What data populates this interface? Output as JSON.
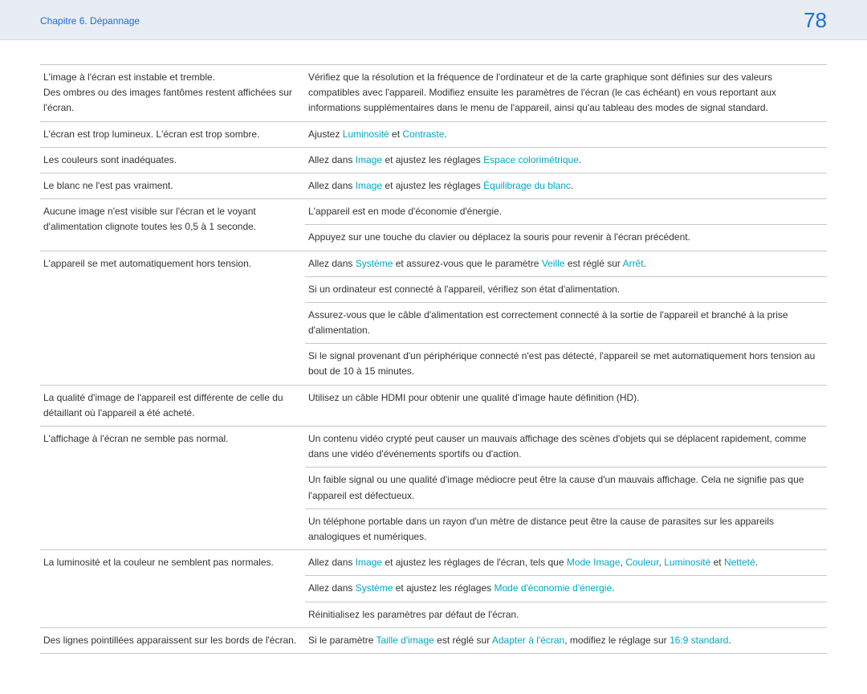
{
  "header": {
    "chapter": "Chapitre 6. Dépannage",
    "page": "78"
  },
  "terms": {
    "luminosite": "Luminosité",
    "contraste": "Contraste",
    "image": "Image",
    "espace_color": "Espace colorimétrique",
    "equilibrage_blanc": "Équilibrage du blanc",
    "systeme": "Système",
    "veille": "Veille",
    "arret": "Arrêt",
    "mode_image": "Mode Image",
    "couleur": "Couleur",
    "nettete": "Netteté",
    "mode_eco": "Mode d'économie d'énergie",
    "taille_image": "Taille d'image",
    "adapter_ecran": "Adapter à l'écran",
    "standard169": "16:9 standard"
  },
  "rows": {
    "r1": {
      "left": "L'image à l'écran est instable et tremble.",
      "left2": "Des ombres ou des images fantômes restent affichées sur l'écran.",
      "right": "Vérifiez que la résolution et la fréquence de l'ordinateur et de la carte graphique sont définies sur des valeurs compatibles avec l'appareil. Modifiez ensuite les paramètres de l'écran (le cas échéant) en vous reportant aux informations supplémentaires dans le menu de l'appareil, ainsi qu'au tableau des modes de signal standard."
    },
    "r2": {
      "left": "L'écran est trop lumineux. L'écran est trop sombre.",
      "right_pre": "Ajustez ",
      "right_mid": " et ",
      "right_post": "."
    },
    "r3": {
      "left": "Les couleurs sont inadéquates.",
      "right_pre": "Allez dans ",
      "right_mid": " et ajustez les réglages ",
      "right_post": "."
    },
    "r4": {
      "left": "Le blanc ne l'est pas vraiment.",
      "right_pre": "Allez dans ",
      "right_mid": " et ajustez les réglages ",
      "right_post": "."
    },
    "r5": {
      "left": "Aucune image n'est visible sur l'écran et le voyant d'alimentation clignote toutes les 0,5 à 1 seconde.",
      "right1": "L'appareil est en mode d'économie d'énergie.",
      "right2": "Appuyez sur une touche du clavier ou déplacez la souris pour revenir à l'écran précédent."
    },
    "r6": {
      "left": "L'appareil se met automatiquement hors tension.",
      "right1_pre": "Allez dans ",
      "right1_mid1": " et assurez-vous que le paramètre ",
      "right1_mid2": " est réglé sur ",
      "right1_post": ".",
      "right2": "Si un ordinateur est connecté à l'appareil, vérifiez son état d'alimentation.",
      "right3": "Assurez-vous que le câble d'alimentation est correctement connecté à la sortie de l'appareil et branché à la prise d'alimentation.",
      "right4": "Si le signal provenant d'un périphérique connecté n'est pas détecté, l'appareil se met automatiquement hors tension au bout de 10 à 15 minutes."
    },
    "r7": {
      "left": "La qualité d'image de l'appareil est différente de celle du détaillant où l'appareil a été acheté.",
      "right": "Utilisez un câble HDMI pour obtenir une qualité d'image haute définition (HD)."
    },
    "r8": {
      "left": "L'affichage à l'écran ne semble pas normal.",
      "right1": "Un contenu vidéo crypté peut causer un mauvais affichage des scènes d'objets qui se déplacent rapidement, comme dans une vidéo d'événements sportifs ou d'action.",
      "right2": "Un faible signal ou une qualité d'image médiocre peut être la cause d'un mauvais affichage. Cela ne signifie pas que l'appareil est défectueux.",
      "right3": "Un téléphone portable dans un rayon d'un mètre de distance peut être la cause de parasites sur les appareils analogiques et numériques."
    },
    "r9": {
      "left": "La luminosité et la couleur ne semblent pas normales.",
      "right1_pre": "Allez dans ",
      "right1_mid1": " et ajustez les réglages de l'écran, tels que ",
      "right1_comma": ", ",
      "right1_et": " et ",
      "right1_post": ".",
      "right2_pre": "Allez dans ",
      "right2_mid": " et ajustez les réglages ",
      "right2_post": ".",
      "right3": "Réinitialisez les paramètres par défaut de l'écran."
    },
    "r10": {
      "left": "Des lignes pointillées apparaissent sur les bords de l'écran.",
      "right_pre": "Si le paramètre ",
      "right_mid1": " est réglé sur ",
      "right_mid2": ", modifiez le réglage sur ",
      "right_post": "."
    }
  }
}
